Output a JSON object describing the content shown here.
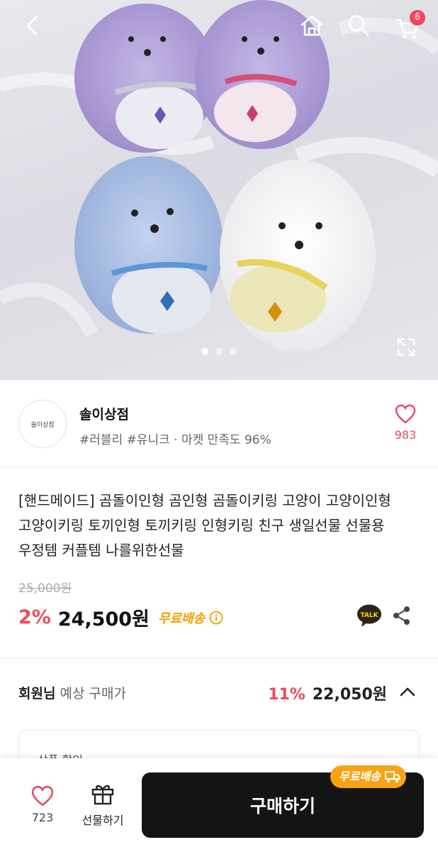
{
  "header": {
    "back_icon": "chevron-left-icon",
    "home_icon": "home-icon",
    "search_icon": "search-icon",
    "cart_icon": "cart-icon",
    "cart_count": "6"
  },
  "gallery": {
    "current_slide": 1,
    "slide_count": 3,
    "expand_icon": "expand-icon"
  },
  "store": {
    "logo_text": "솔이상점",
    "name": "솔이상점",
    "tags": "#러블리 #유니크 · 마켓 만족도 96%",
    "like_count": "983"
  },
  "product": {
    "title": "[핸드메이드] 곰돌이인형 곰인형 곰돌이키링 고양이 고양이인형 고양이키링 토끼인형 토끼키링 인형키링 친구 생일선물 선물용 우정템 커플템 나를위한선물",
    "original_price": "25,000원",
    "discount": "2%",
    "price": "24,500원",
    "shipping": "무료배송"
  },
  "member": {
    "label_bold": "회원님",
    "label_rest": " 예상 구매가",
    "discount": "11%",
    "price": "22,050원"
  },
  "coupon": {
    "label": "상품 할인"
  },
  "bottom_bar": {
    "like_count": "723",
    "gift_label": "선물하기",
    "buy_label": "구매하기",
    "ship_badge": "무료배송"
  },
  "colors": {
    "accent_red": "#f04a5a",
    "heart_pink": "#e74a6a",
    "shipping_orange": "#f7a313",
    "buy_button": "#141414"
  }
}
